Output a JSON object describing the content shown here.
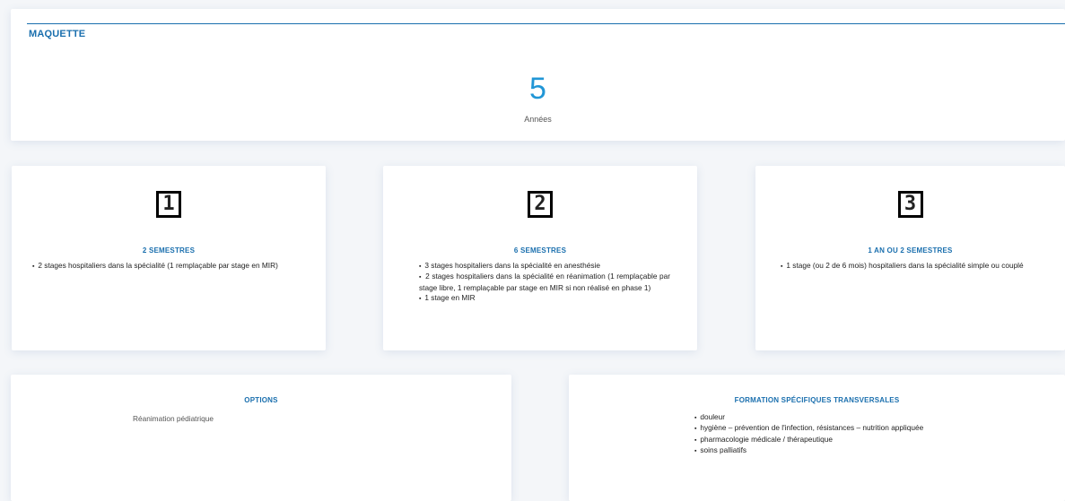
{
  "maquette": {
    "title": "MAQUETTE",
    "duration_value": "5",
    "duration_unit": "Années"
  },
  "phases": [
    {
      "number": "1",
      "title": "2 SEMESTRES",
      "items": [
        "2 stages hospitaliers dans la spécialité (1 remplaçable par stage en MIR)"
      ]
    },
    {
      "number": "2",
      "title": "6 SEMESTRES",
      "items": [
        "3 stages hospitaliers dans la spécialité en anesthésie",
        "2 stages hospitaliers dans la spécialité en réanimation (1 remplaçable par stage libre, 1 remplaçable par stage en MIR si non réalisé en phase 1)",
        "1 stage en MIR"
      ]
    },
    {
      "number": "3",
      "title": "1 AN OU 2 SEMESTRES",
      "items": [
        "1 stage (ou 2 de 6 mois) hospitaliers dans la spécialité simple ou couplé"
      ]
    }
  ],
  "options": {
    "title": "OPTIONS",
    "text": "Réanimation pédiatrique"
  },
  "formation": {
    "title": "FORMATION SPÉCIFIQUES TRANSVERSALES",
    "items": [
      "douleur",
      "hygiène – prévention de l'infection, résistances – nutrition appliquée",
      "pharmacologie médicale / thérapeutique",
      "soins palliatifs"
    ]
  },
  "colors": {
    "accent": "#1a6fae",
    "big_number": "#2196d6"
  }
}
